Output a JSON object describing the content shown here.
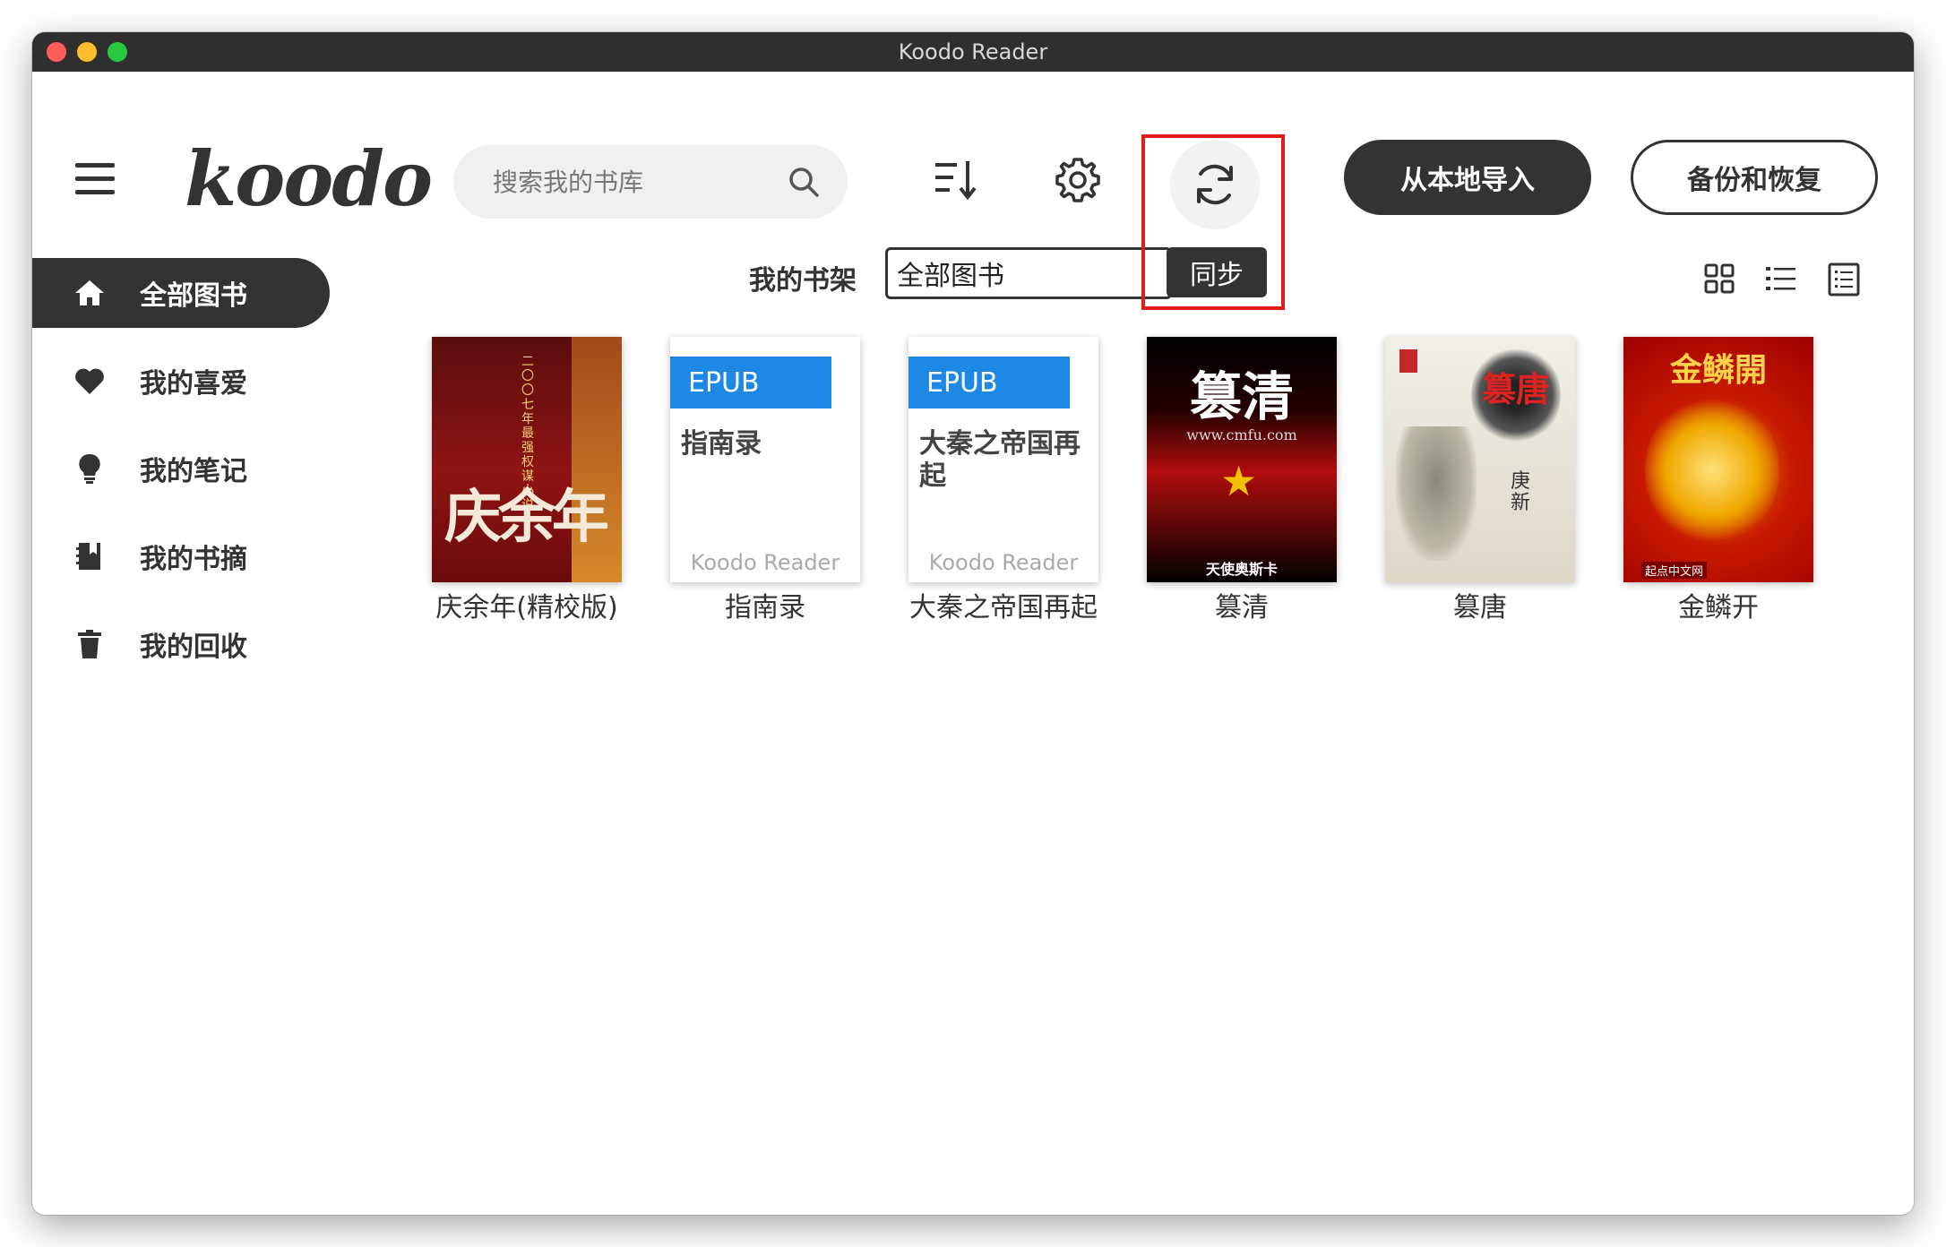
{
  "window": {
    "title": "Koodo Reader"
  },
  "header": {
    "logo": "koodo",
    "search": {
      "placeholder": "搜索我的书库",
      "value": ""
    },
    "sync_tooltip": "同步",
    "import_button": "从本地导入",
    "backup_button": "备份和恢复"
  },
  "sidebar": {
    "items": [
      {
        "label": "全部图书",
        "icon": "home-icon",
        "active": true
      },
      {
        "label": "我的喜爱",
        "icon": "heart-icon"
      },
      {
        "label": "我的笔记",
        "icon": "lightbulb-icon"
      },
      {
        "label": "我的书摘",
        "icon": "bookmark-book-icon"
      },
      {
        "label": "我的回收",
        "icon": "trash-icon"
      }
    ]
  },
  "shelf": {
    "label": "我的书架",
    "selected": "全部图书"
  },
  "books": [
    {
      "title": "庆余年(精校版)",
      "cover": "image",
      "cover_text": "庆余年",
      "cover_side_text": "二〇〇七年最强权谋小说"
    },
    {
      "title": "指南录",
      "cover": "epub",
      "tag": "EPUB",
      "cover_title": "指南录",
      "brand": "Koodo Reader"
    },
    {
      "title": "大秦之帝国再起",
      "cover": "epub",
      "tag": "EPUB",
      "cover_title": "大秦之帝国再起",
      "brand": "Koodo Reader"
    },
    {
      "title": "篡清",
      "cover": "image",
      "cover_text": "篡清",
      "cover_url": "www.cmfu.com",
      "cover_bottom": "天使奥斯卡"
    },
    {
      "title": "篡唐",
      "cover": "image",
      "cover_text": "篡唐",
      "cover_author": "庚新"
    },
    {
      "title": "金鳞开",
      "cover": "image",
      "cover_text": "金鳞開",
      "cover_bottom": "起点中文网"
    }
  ],
  "colors": {
    "accent_dark": "#333333",
    "epub_blue": "#1e88e5",
    "highlight_red": "#e21b1b"
  }
}
